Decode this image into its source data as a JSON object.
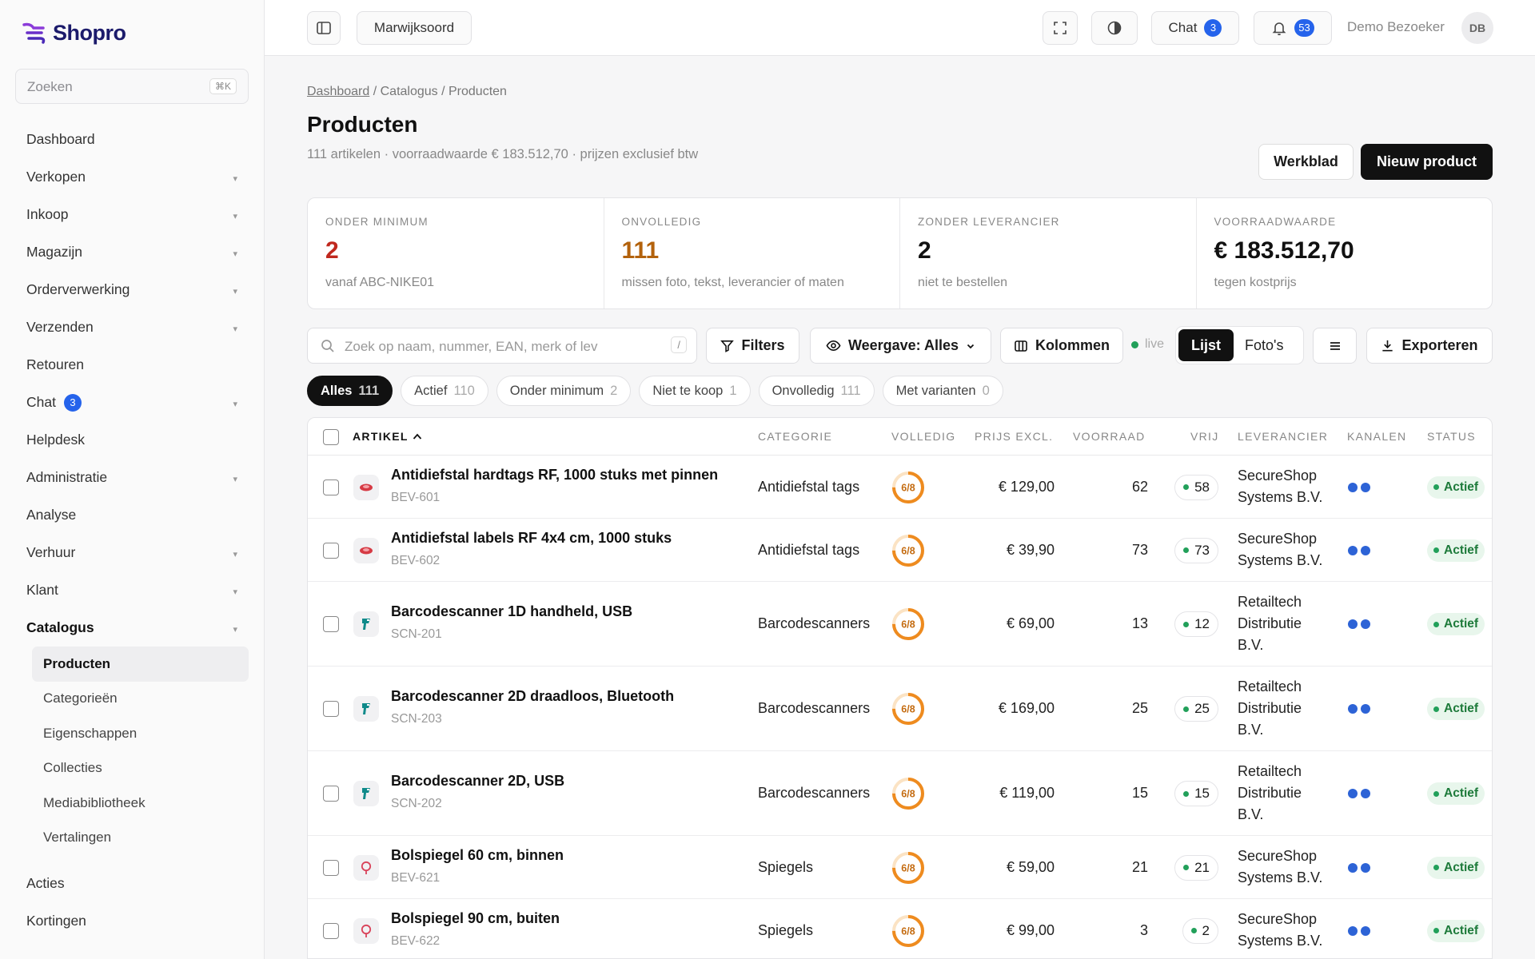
{
  "app": {
    "name": "Shopro",
    "brand_color": "#1c1b6b",
    "accent": "#2563eb"
  },
  "sidebar": {
    "search_placeholder": "Zoeken",
    "search_shortcut": "⌘K",
    "items": [
      {
        "label": "Dashboard",
        "chevron": false
      },
      {
        "label": "Verkopen",
        "chevron": true
      },
      {
        "label": "Inkoop",
        "chevron": true
      },
      {
        "label": "Magazijn",
        "chevron": true
      },
      {
        "label": "Orderverwerking",
        "chevron": true
      },
      {
        "label": "Verzenden",
        "chevron": true
      },
      {
        "label": "Retouren",
        "chevron": false
      },
      {
        "label": "Chat",
        "chevron": true,
        "badge": "3"
      },
      {
        "label": "Helpdesk",
        "chevron": false
      },
      {
        "label": "Administratie",
        "chevron": true
      },
      {
        "label": "Analyse",
        "chevron": false
      },
      {
        "label": "Verhuur",
        "chevron": true
      },
      {
        "label": "Klant",
        "chevron": true
      },
      {
        "label": "Catalogus",
        "chevron": true,
        "active": true
      }
    ],
    "subitems": [
      "Producten",
      "Categorieën",
      "Eigenschappen",
      "Collecties",
      "Mediabibliotheek",
      "Vertalingen"
    ],
    "bottom_items": [
      "Acties",
      "Kortingen"
    ]
  },
  "topbar": {
    "location": "Marwijksoord",
    "chat_label": "Chat",
    "chat_count": "3",
    "notif_count": "53",
    "user_name": "Demo Bezoeker",
    "user_initials": "DB"
  },
  "page": {
    "crumb_dashboard": "Dashboard",
    "crumb_rest": " / Catalogus / Producten",
    "title": "Producten",
    "subtitle": "111 artikelen · voorraadwaarde € 183.512,70 · prijzen exclusief btw",
    "btn_sheet": "Werkblad",
    "btn_new": "Nieuw product"
  },
  "stats": [
    {
      "label": "ONDER MINIMUM",
      "value": "2",
      "sub": "vanaf ABC-NIKE01",
      "color": "#c0281e"
    },
    {
      "label": "ONVOLLEDIG",
      "value": "111",
      "sub": "missen foto, tekst, leverancier of maten",
      "color": "#b3620c"
    },
    {
      "label": "ZONDER LEVERANCIER",
      "value": "2",
      "sub": "niet te bestellen",
      "color": "#111111"
    },
    {
      "label": "VOORRAADWAARDE",
      "value": "€ 183.512,70",
      "sub": "tegen kostprijs",
      "color": "#111111"
    }
  ],
  "toolbar": {
    "search_placeholder": "Zoek op naam, nummer, EAN, merk of lev",
    "search_shortcut": "/",
    "filters": "Filters",
    "view": "Weergave: Alles",
    "columns": "Kolommen",
    "live": "live",
    "list": "Lijst",
    "photos": "Foto's",
    "export": "Exporteren"
  },
  "chips": [
    {
      "label": "Alles",
      "count": "111",
      "active": true
    },
    {
      "label": "Actief",
      "count": "110"
    },
    {
      "label": "Onder minimum",
      "count": "2"
    },
    {
      "label": "Niet te koop",
      "count": "1"
    },
    {
      "label": "Onvolledig",
      "count": "111"
    },
    {
      "label": "Met varianten",
      "count": "0"
    }
  ],
  "table": {
    "headers": {
      "artikel": "ARTIKEL",
      "categorie": "CATEGORIE",
      "volledig": "VOLLEDIG",
      "prijs": "PRIJS EXCL.",
      "voorraad": "VOORRAAD",
      "vrij": "VRIJ",
      "leverancier": "LEVERANCIER",
      "kanalen": "KANALEN",
      "status": "STATUS"
    },
    "rows": [
      {
        "name": "Antidiefstal hardtags RF, 1000 stuks met pinnen",
        "sku": "BEV-601",
        "icon": "tag-icon",
        "category": "Antidiefstal tags",
        "complete": "6/8",
        "complete_ratio": 0.75,
        "price": "€ 129,00",
        "stock": "62",
        "free": "58",
        "supplier": [
          "SecureShop",
          "Systems B.V."
        ],
        "status": "Actief"
      },
      {
        "name": "Antidiefstal labels RF 4x4 cm, 1000 stuks",
        "sku": "BEV-602",
        "icon": "tag-icon",
        "category": "Antidiefstal tags",
        "complete": "6/8",
        "complete_ratio": 0.75,
        "price": "€ 39,90",
        "stock": "73",
        "free": "73",
        "supplier": [
          "SecureShop",
          "Systems B.V."
        ],
        "status": "Actief"
      },
      {
        "name": "Barcodescanner 1D handheld, USB",
        "sku": "SCN-201",
        "icon": "scanner-icon",
        "category": "Barcodescanners",
        "complete": "6/8",
        "complete_ratio": 0.75,
        "price": "€ 69,00",
        "stock": "13",
        "free": "12",
        "supplier": [
          "Retailtech",
          "Distributie",
          "B.V."
        ],
        "status": "Actief"
      },
      {
        "name": "Barcodescanner 2D draadloos, Bluetooth",
        "sku": "SCN-203",
        "icon": "scanner-icon",
        "category": "Barcodescanners",
        "complete": "6/8",
        "complete_ratio": 0.75,
        "price": "€ 169,00",
        "stock": "25",
        "free": "25",
        "supplier": [
          "Retailtech",
          "Distributie",
          "B.V."
        ],
        "status": "Actief"
      },
      {
        "name": "Barcodescanner 2D, USB",
        "sku": "SCN-202",
        "icon": "scanner-icon",
        "category": "Barcodescanners",
        "complete": "6/8",
        "complete_ratio": 0.75,
        "price": "€ 119,00",
        "stock": "15",
        "free": "15",
        "supplier": [
          "Retailtech",
          "Distributie",
          "B.V."
        ],
        "status": "Actief"
      },
      {
        "name": "Bolspiegel 60 cm, binnen",
        "sku": "BEV-621",
        "icon": "mirror-icon",
        "category": "Spiegels",
        "complete": "6/8",
        "complete_ratio": 0.75,
        "price": "€ 59,00",
        "stock": "21",
        "free": "21",
        "supplier": [
          "SecureShop",
          "Systems B.V."
        ],
        "status": "Actief"
      },
      {
        "name": "Bolspiegel 90 cm, buiten",
        "sku": "BEV-622",
        "icon": "mirror-icon",
        "category": "Spiegels",
        "complete": "6/8",
        "complete_ratio": 0.75,
        "price": "€ 99,00",
        "stock": "3",
        "free": "2",
        "supplier": [
          "SecureShop",
          "Systems B.V."
        ],
        "status": "Actief"
      }
    ]
  }
}
